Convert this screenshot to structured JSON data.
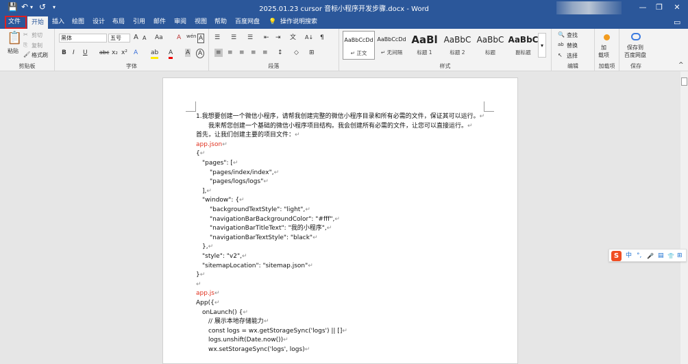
{
  "titlebar": {
    "title": "2025.01.23  cursor  音标小程序开发步骤.docx  -  Word",
    "save_icon": "💾",
    "undo_icon": "↶",
    "undo_drop": "▾",
    "redo_icon": "↺",
    "qa_more": "▾",
    "min": "—",
    "max": "❐",
    "close": "✕"
  },
  "menu": {
    "file": "文件",
    "home": "开始",
    "insert": "插入",
    "draw": "绘图",
    "design": "设计",
    "layout": "布局",
    "references": "引用",
    "mailings": "邮件",
    "review": "审阅",
    "view": "视图",
    "help": "帮助",
    "baidu": "百度网盘",
    "tell": "操作说明搜索",
    "bulb": "💡",
    "comment_icon": "▭"
  },
  "ribbon": {
    "clipboard": {
      "paste": "粘贴",
      "cut": "剪切",
      "copy": "复制",
      "format_painter": "格式刷",
      "label": "剪贴板",
      "paste_icon": "📋",
      "cut_icon": "✂",
      "copy_icon": "⎘",
      "fp_icon": "🖌"
    },
    "font": {
      "font_name": "黑体",
      "font_size": "五号",
      "label": "字体",
      "grow": "A",
      "shrink": "A",
      "aa": "Aa",
      "clear": "A",
      "wen": "wén",
      "a_box": "A",
      "bold": "B",
      "italic": "I",
      "underline": "U",
      "strike": "abc",
      "sub": "x₂",
      "sup": "x²",
      "effects": "A",
      "highlight": "ab",
      "color": "A",
      "shade": "A",
      "circle": "A",
      "dd": "▾"
    },
    "paragraph": {
      "label": "段落",
      "bullets": "☰",
      "numbering": "☰",
      "multilevel": "☰",
      "dec_indent": "⇤",
      "inc_indent": "⇥",
      "chinese": "文",
      "sort": "A↓",
      "marks": "¶",
      "align_left": "≡",
      "center": "≡",
      "align_right": "≡",
      "justify": "≡",
      "distribute": "≡",
      "spacing": "↕",
      "shading": "◇",
      "borders": "⊞"
    },
    "styles": {
      "label": "样式",
      "items": [
        {
          "preview": "AaBbCcDd",
          "name": "↵ 正文"
        },
        {
          "preview": "AaBbCcDd",
          "name": "↵ 无间隔"
        },
        {
          "preview": "AaBl",
          "name": "标题 1"
        },
        {
          "preview": "AaBbC",
          "name": "标题 2"
        },
        {
          "preview": "AaBbC",
          "name": "标题"
        },
        {
          "preview": "AaBbC",
          "name": "副标题"
        }
      ],
      "scroll": "▾"
    },
    "editing": {
      "find": "查找",
      "replace": "替换",
      "select": "选择",
      "label": "编辑",
      "find_icon": "🔍",
      "replace_icon": "ab",
      "select_icon": "↖"
    },
    "addin": {
      "label": "加载项",
      "btn": "加\n载项"
    },
    "save": {
      "label": "保存",
      "btn": "保存到\n百度网盘"
    },
    "collapse": "^"
  },
  "doc": {
    "lines": [
      {
        "text": "1.我想要创建一个微信小程序，请帮我创建完整的微信小程序目录和所有必需的文件，保证其可以运行。",
        "x": 0,
        "red": false
      },
      {
        "text": "我来帮您创建一个基础的微信小程序项目结构。我会创建所有必需的文件，让您可以直接运行。",
        "x": 18,
        "red": false
      },
      {
        "text": "首先，让我们创建主要的项目文件：",
        "x": 0,
        "red": false
      },
      {
        "text": "app.json",
        "x": 0,
        "red": true
      },
      {
        "text": "{",
        "x": 0,
        "red": false
      },
      {
        "text": "\"pages\": [",
        "x": 9,
        "red": false
      },
      {
        "text": "\"pages/index/index\",",
        "x": 20,
        "red": false
      },
      {
        "text": "\"pages/logs/logs\"",
        "x": 20,
        "red": false
      },
      {
        "text": "],",
        "x": 9,
        "red": false
      },
      {
        "text": "\"window\": {",
        "x": 9,
        "red": false
      },
      {
        "text": "\"backgroundTextStyle\": \"light\",",
        "x": 20,
        "red": false
      },
      {
        "text": "\"navigationBarBackgroundColor\": \"#fff\",",
        "x": 20,
        "red": false
      },
      {
        "text": "\"navigationBarTitleText\": \"我的小程序\",",
        "x": 20,
        "red": false
      },
      {
        "text": "\"navigationBarTextStyle\": \"black\"",
        "x": 20,
        "red": false
      },
      {
        "text": "},",
        "x": 9,
        "red": false
      },
      {
        "text": "\"style\": \"v2\",",
        "x": 9,
        "red": false
      },
      {
        "text": "\"sitemapLocation\": \"sitemap.json\"",
        "x": 9,
        "red": false
      },
      {
        "text": "}",
        "x": 0,
        "red": false
      },
      {
        "text": "",
        "x": 0,
        "red": false
      },
      {
        "text": "app.js",
        "x": 0,
        "red": true
      },
      {
        "text": "App({",
        "x": 0,
        "red": false
      },
      {
        "text": "onLaunch() {",
        "x": 9,
        "red": false
      },
      {
        "text": "// 展示本地存储能力",
        "x": 18,
        "red": false
      },
      {
        "text": "const logs = wx.getStorageSync('logs') || []",
        "x": 18,
        "red": false
      },
      {
        "text": "logs.unshift(Date.now())",
        "x": 18,
        "red": false
      },
      {
        "text": "wx.setStorageSync('logs', logs)",
        "x": 18,
        "red": false
      }
    ],
    "return_mark": "↵"
  },
  "ime": {
    "logo": "S",
    "zh": "中",
    "punct": "°,",
    "mic": "🎤",
    "kbd": "▤",
    "skin": "👕",
    "grid": "⊞"
  }
}
